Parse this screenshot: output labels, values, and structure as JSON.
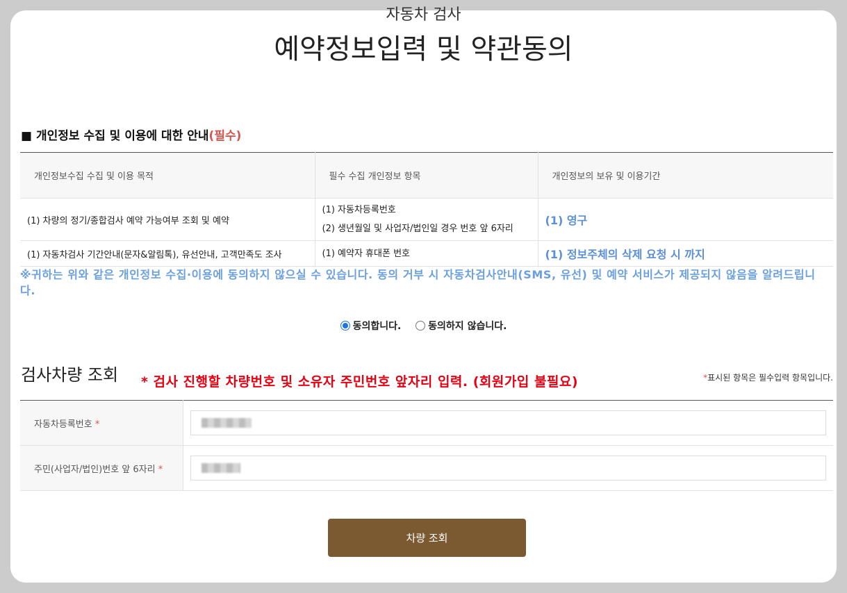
{
  "header": {
    "subtitle": "자동차 검사",
    "title": "예약정보입력 및 약관동의"
  },
  "privacy": {
    "title": "개인정보 수집 및 이용에 대한 안내",
    "required_tag": "(필수)",
    "columns": [
      "개인정보수집 수집 및 이용 목적",
      "필수 수집 개인정보 항목",
      "개인정보의 보유 및 이용기간"
    ],
    "rows": [
      {
        "purpose": "(1) 차량의 정기/종합검사 예약 가능여부 조회 및 예약",
        "items": [
          "(1) 자동차등록번호",
          "(2) 생년월일 및 사업자/법인일 경우 번호 앞 6자리"
        ],
        "period": "(1) 영구"
      },
      {
        "purpose": "(1) 자동차검사 기간안내(문자&알림톡), 유선안내, 고객만족도 조사",
        "items": [
          "(1) 예약자 휴대폰 번호"
        ],
        "period": "(1) 정보주체의 삭제 요청 시 까지"
      }
    ],
    "notice": "※귀하는 위와 같은 개인정보 수집·이용에 동의하지 않으실 수 있습니다. 동의 거부 시 자동차검사안내(SMS, 유선) 및 예약 서비스가 제공되지 않음을 알려드립니다."
  },
  "consent": {
    "agree_label": "동의합니다.",
    "disagree_label": "동의하지 않습니다.",
    "selected": "agree"
  },
  "lookup": {
    "title": "검사차량 조회",
    "warning": "* 검사 진행할 차량번호 및 소유자 주민번호 앞자리 입력. (회원가입 불필요)",
    "required_note_star": "*",
    "required_note": "표시된 항목은 필수입력 항목입니다.",
    "fields": [
      {
        "label": "자동차등록번호",
        "star": "*"
      },
      {
        "label": "주민(사업자/법인)번호 앞 6자리",
        "star": "*"
      }
    ],
    "submit_label": "차량 조회"
  }
}
